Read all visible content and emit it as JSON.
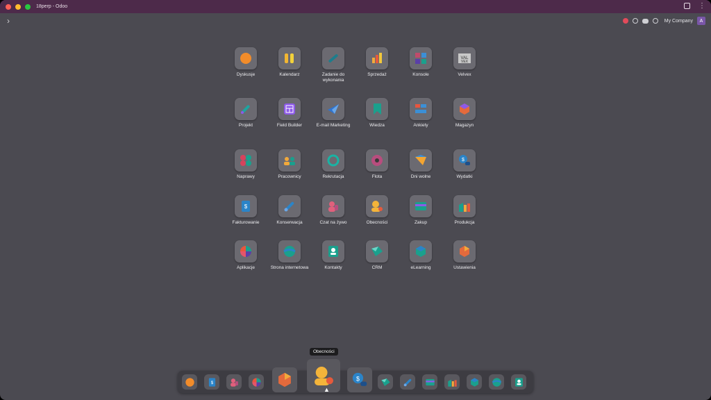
{
  "window": {
    "title": "18perp - Odoo"
  },
  "systray": {
    "company": "My Company",
    "avatar_letter": "A"
  },
  "apps": [
    {
      "label": "Dyskusje",
      "icon": "discuss-icon",
      "color": "#f28c2a"
    },
    {
      "label": "Kalendarz",
      "icon": "calendar-icon",
      "color": "#f2b632"
    },
    {
      "label": "Zadanie do wykonania",
      "icon": "todo-icon",
      "color": "#1d7d8c"
    },
    {
      "label": "Sprzedaż",
      "icon": "sales-icon",
      "color": "#e65a3c"
    },
    {
      "label": "Konsole",
      "icon": "console-icon",
      "color": "#c04b6b"
    },
    {
      "label": "Velvex",
      "icon": "velvex-icon",
      "color": "#2d2d2d"
    },
    {
      "label": "Projekt",
      "icon": "project-icon",
      "color": "#1ea4a0"
    },
    {
      "label": "Field Builder",
      "icon": "field-builder-icon",
      "color": "#8d5ae8"
    },
    {
      "label": "E-mail Marketing",
      "icon": "email-marketing-icon",
      "color": "#2f74d0"
    },
    {
      "label": "Wiedza",
      "icon": "knowledge-icon",
      "color": "#1aa08d"
    },
    {
      "label": "Ankiety",
      "icon": "surveys-icon",
      "color": "#e8553e"
    },
    {
      "label": "Magazyn",
      "icon": "inventory-icon",
      "color": "#e46a3c"
    },
    {
      "label": "Naprawy",
      "icon": "repairs-icon",
      "color": "#d6435c"
    },
    {
      "label": "Pracownicy",
      "icon": "employees-icon",
      "color": "#f2a93b"
    },
    {
      "label": "Rekrutacja",
      "icon": "recruitment-icon",
      "color": "#19b3a4"
    },
    {
      "label": "Flota",
      "icon": "fleet-icon",
      "color": "#b84d7e"
    },
    {
      "label": "Dni wolne",
      "icon": "time-off-icon",
      "color": "#f4a531"
    },
    {
      "label": "Wydatki",
      "icon": "expenses-icon",
      "color": "#2b84c8"
    },
    {
      "label": "Fakturowanie",
      "icon": "invoicing-icon",
      "color": "#2b84c8"
    },
    {
      "label": "Konserwacja",
      "icon": "maintenance-icon",
      "color": "#2b84c8"
    },
    {
      "label": "Czat na żywo",
      "icon": "live-chat-icon",
      "color": "#e0607c"
    },
    {
      "label": "Obecności",
      "icon": "attendances-icon",
      "color": "#f4b43a"
    },
    {
      "label": "Zakup",
      "icon": "purchase-icon",
      "color": "#1aa08d"
    },
    {
      "label": "Produkcja",
      "icon": "manufacturing-icon",
      "color": "#1aa08d"
    },
    {
      "label": "Aplikacje",
      "icon": "apps-icon",
      "color": "#e4566a"
    },
    {
      "label": "Strona internetowa",
      "icon": "website-icon",
      "color": "#1aa08d"
    },
    {
      "label": "Kontakty",
      "icon": "contacts-icon",
      "color": "#1aa08d"
    },
    {
      "label": "CRM",
      "icon": "crm-icon",
      "color": "#1aa08d"
    },
    {
      "label": "eLearning",
      "icon": "elearning-icon",
      "color": "#1aa08d"
    },
    {
      "label": "Ustawienia",
      "icon": "settings-icon",
      "color": "#e46a3c"
    }
  ],
  "dock": {
    "tooltip": "Obecności",
    "items": [
      {
        "icon": "discuss-icon",
        "color": "#f28c2a"
      },
      {
        "icon": "invoicing-icon",
        "color": "#2b84c8"
      },
      {
        "icon": "live-chat-icon",
        "color": "#e0607c"
      },
      {
        "icon": "apps-icon",
        "color": "#e4566a"
      },
      {
        "icon": "settings-icon",
        "color": "#e46a3c"
      },
      {
        "icon": "attendances-icon",
        "color": "#f4b43a"
      },
      {
        "icon": "expenses-icon",
        "color": "#2b84c8"
      },
      {
        "icon": "crm-icon",
        "color": "#1aa08d"
      },
      {
        "icon": "maintenance-icon",
        "color": "#2b84c8"
      },
      {
        "icon": "purchase-icon",
        "color": "#1aa08d"
      },
      {
        "icon": "manufacturing-icon",
        "color": "#1aa08d"
      },
      {
        "icon": "elearning-icon",
        "color": "#1aa08d"
      },
      {
        "icon": "website-icon",
        "color": "#1aa08d"
      },
      {
        "icon": "contacts-icon",
        "color": "#1aa08d"
      }
    ]
  }
}
